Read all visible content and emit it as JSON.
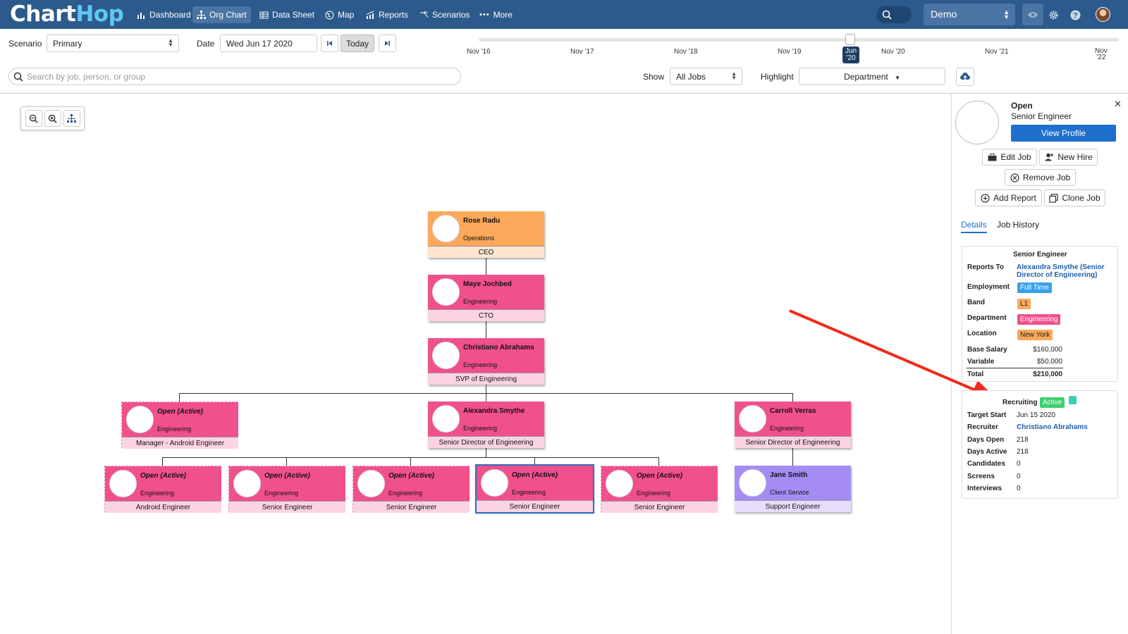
{
  "app": {
    "logo_chart": "Chart",
    "logo_hop": "Hop"
  },
  "nav": {
    "items": [
      "Dashboard",
      "Org Chart",
      "Data Sheet",
      "Map",
      "Reports",
      "Scenarios",
      "More"
    ],
    "org": "Demo"
  },
  "toolbar": {
    "scenario_label": "Scenario",
    "scenario_value": "Primary",
    "date_label": "Date",
    "date_value": "Wed Jun 17 2020",
    "today": "Today",
    "timeline": [
      "Nov '16",
      "Nov '17",
      "Nov '18",
      "Nov '19",
      "Nov '20",
      "Nov '21"
    ],
    "timeline_current": {
      "line1": "Jun",
      "line2": "'20"
    },
    "timeline_last": {
      "line1": "Nov",
      "line2": "'22"
    },
    "search_placeholder": "Search by job, person, or group",
    "show_label": "Show",
    "show_value": "All Jobs",
    "highlight_label": "Highlight",
    "highlight_value": "Department"
  },
  "colors": {
    "operations": "#fba85a",
    "engineering": "#f0508c",
    "client_service": "#a48cf4",
    "accent": "#1f6fcf"
  },
  "org": {
    "ceo": {
      "name": "Rose Radu",
      "dept": "Operations",
      "title": "CEO"
    },
    "cto": {
      "name": "Maye Jochbed",
      "dept": "Engineering",
      "title": "CTO"
    },
    "svp": {
      "name": "Christiano Abrahams",
      "dept": "Engineering",
      "title": "SVP of Engineering"
    },
    "l3": [
      {
        "name": "Open (Active)",
        "dept": "Engineering",
        "title": "Manager - Android Engineer"
      },
      {
        "name": "Alexandra Smythe",
        "dept": "Engineering",
        "title": "Senior Director of Engineering"
      },
      {
        "name": "Carroll Verras",
        "dept": "Engineering",
        "title": "Senior Director of Engineering"
      }
    ],
    "l4": [
      {
        "name": "Open (Active)",
        "dept": "Engineering",
        "title": "Android Engineer"
      },
      {
        "name": "Open (Active)",
        "dept": "Engineering",
        "title": "Senior Engineer"
      },
      {
        "name": "Open (Active)",
        "dept": "Engineering",
        "title": "Senior Engineer"
      },
      {
        "name": "Open (Active)",
        "dept": "Engineering",
        "title": "Senior Engineer"
      },
      {
        "name": "Open (Active)",
        "dept": "Engineering",
        "title": "Senior Engineer"
      },
      {
        "name": "Jane Smith",
        "dept": "Client Service",
        "title": "Support Engineer"
      }
    ]
  },
  "panel": {
    "title": "Open",
    "subtitle": "Senior Engineer",
    "view_profile": "View Profile",
    "edit_job": "Edit Job",
    "new_hire": "New Hire",
    "remove_job": "Remove Job",
    "add_report": "Add Report",
    "clone_job": "Clone Job",
    "tab_details": "Details",
    "tab_history": "Job History",
    "details": {
      "heading": "Senior Engineer",
      "reports_to_label": "Reports To",
      "reports_to_line1": "Alexandra Smythe (Senior",
      "reports_to_line2": "Director of Engineering)",
      "employment_label": "Employment",
      "employment": "Full Time",
      "band_label": "Band",
      "band": "L1",
      "department_label": "Department",
      "department": "Engineering",
      "location_label": "Location",
      "location": "New York",
      "base_label": "Base Salary",
      "base": "$160,000",
      "variable_label": "Variable",
      "variable": "$50,000",
      "total_label": "Total",
      "total": "$210,000"
    },
    "recruiting": {
      "heading": "Recruiting",
      "status": "Active",
      "target_start_label": "Target Start",
      "target_start": "Jun 15 2020",
      "recruiter_label": "Recruiter",
      "recruiter": "Christiano Abrahams",
      "days_open_label": "Days Open",
      "days_open": "218",
      "days_active_label": "Days Active",
      "days_active": "218",
      "candidates_label": "Candidates",
      "candidates": "0",
      "screens_label": "Screens",
      "screens": "0",
      "interviews_label": "Interviews",
      "interviews": "0"
    }
  }
}
